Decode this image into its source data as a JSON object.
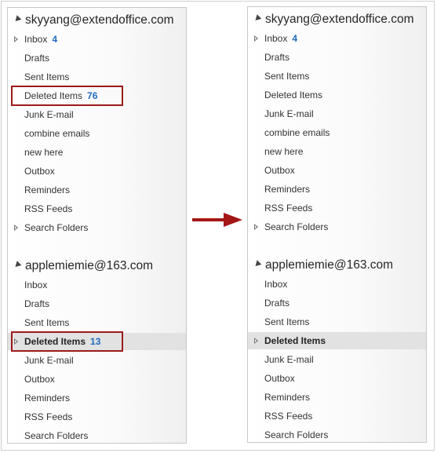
{
  "colors": {
    "count_blue": "#1f6bbf",
    "highlight_red": "#9b1b1b",
    "arrow_red": "#a51616"
  },
  "left": {
    "account1": {
      "name": "skyyang@extendoffice.com",
      "items": [
        {
          "label": "Inbox",
          "count": "4",
          "expandable": true
        },
        {
          "label": "Drafts",
          "count": ""
        },
        {
          "label": "Sent Items",
          "count": ""
        },
        {
          "label": "Deleted Items",
          "count": "76",
          "highlighted": true
        },
        {
          "label": "Junk E-mail",
          "count": ""
        },
        {
          "label": "combine emails",
          "count": ""
        },
        {
          "label": "new here",
          "count": ""
        },
        {
          "label": "Outbox",
          "count": ""
        },
        {
          "label": "Reminders",
          "count": ""
        },
        {
          "label": "RSS Feeds",
          "count": ""
        },
        {
          "label": "Search Folders",
          "count": "",
          "expandable": true
        }
      ]
    },
    "account2": {
      "name": "applemiemie@163.com",
      "items": [
        {
          "label": "Inbox",
          "count": ""
        },
        {
          "label": "Drafts",
          "count": ""
        },
        {
          "label": "Sent Items",
          "count": ""
        },
        {
          "label": "Deleted Items",
          "count": "13",
          "expandable": true,
          "selected": true,
          "bold": true,
          "highlighted": true
        },
        {
          "label": "Junk E-mail",
          "count": ""
        },
        {
          "label": "Outbox",
          "count": ""
        },
        {
          "label": "Reminders",
          "count": ""
        },
        {
          "label": "RSS Feeds",
          "count": ""
        },
        {
          "label": "Search Folders",
          "count": ""
        }
      ]
    }
  },
  "right": {
    "account1": {
      "name": "skyyang@extendoffice.com",
      "items": [
        {
          "label": "Inbox",
          "count": "4",
          "expandable": true
        },
        {
          "label": "Drafts",
          "count": ""
        },
        {
          "label": "Sent Items",
          "count": ""
        },
        {
          "label": "Deleted Items",
          "count": ""
        },
        {
          "label": "Junk E-mail",
          "count": ""
        },
        {
          "label": "combine emails",
          "count": ""
        },
        {
          "label": "new here",
          "count": ""
        },
        {
          "label": "Outbox",
          "count": ""
        },
        {
          "label": "Reminders",
          "count": ""
        },
        {
          "label": "RSS Feeds",
          "count": ""
        },
        {
          "label": "Search Folders",
          "count": "",
          "expandable": true
        }
      ]
    },
    "account2": {
      "name": "applemiemie@163.com",
      "items": [
        {
          "label": "Inbox",
          "count": ""
        },
        {
          "label": "Drafts",
          "count": ""
        },
        {
          "label": "Sent Items",
          "count": ""
        },
        {
          "label": "Deleted Items",
          "count": "",
          "expandable": true,
          "selected": true,
          "bold": true
        },
        {
          "label": "Junk E-mail",
          "count": ""
        },
        {
          "label": "Outbox",
          "count": ""
        },
        {
          "label": "Reminders",
          "count": ""
        },
        {
          "label": "RSS Feeds",
          "count": ""
        },
        {
          "label": "Search Folders",
          "count": ""
        }
      ]
    }
  }
}
